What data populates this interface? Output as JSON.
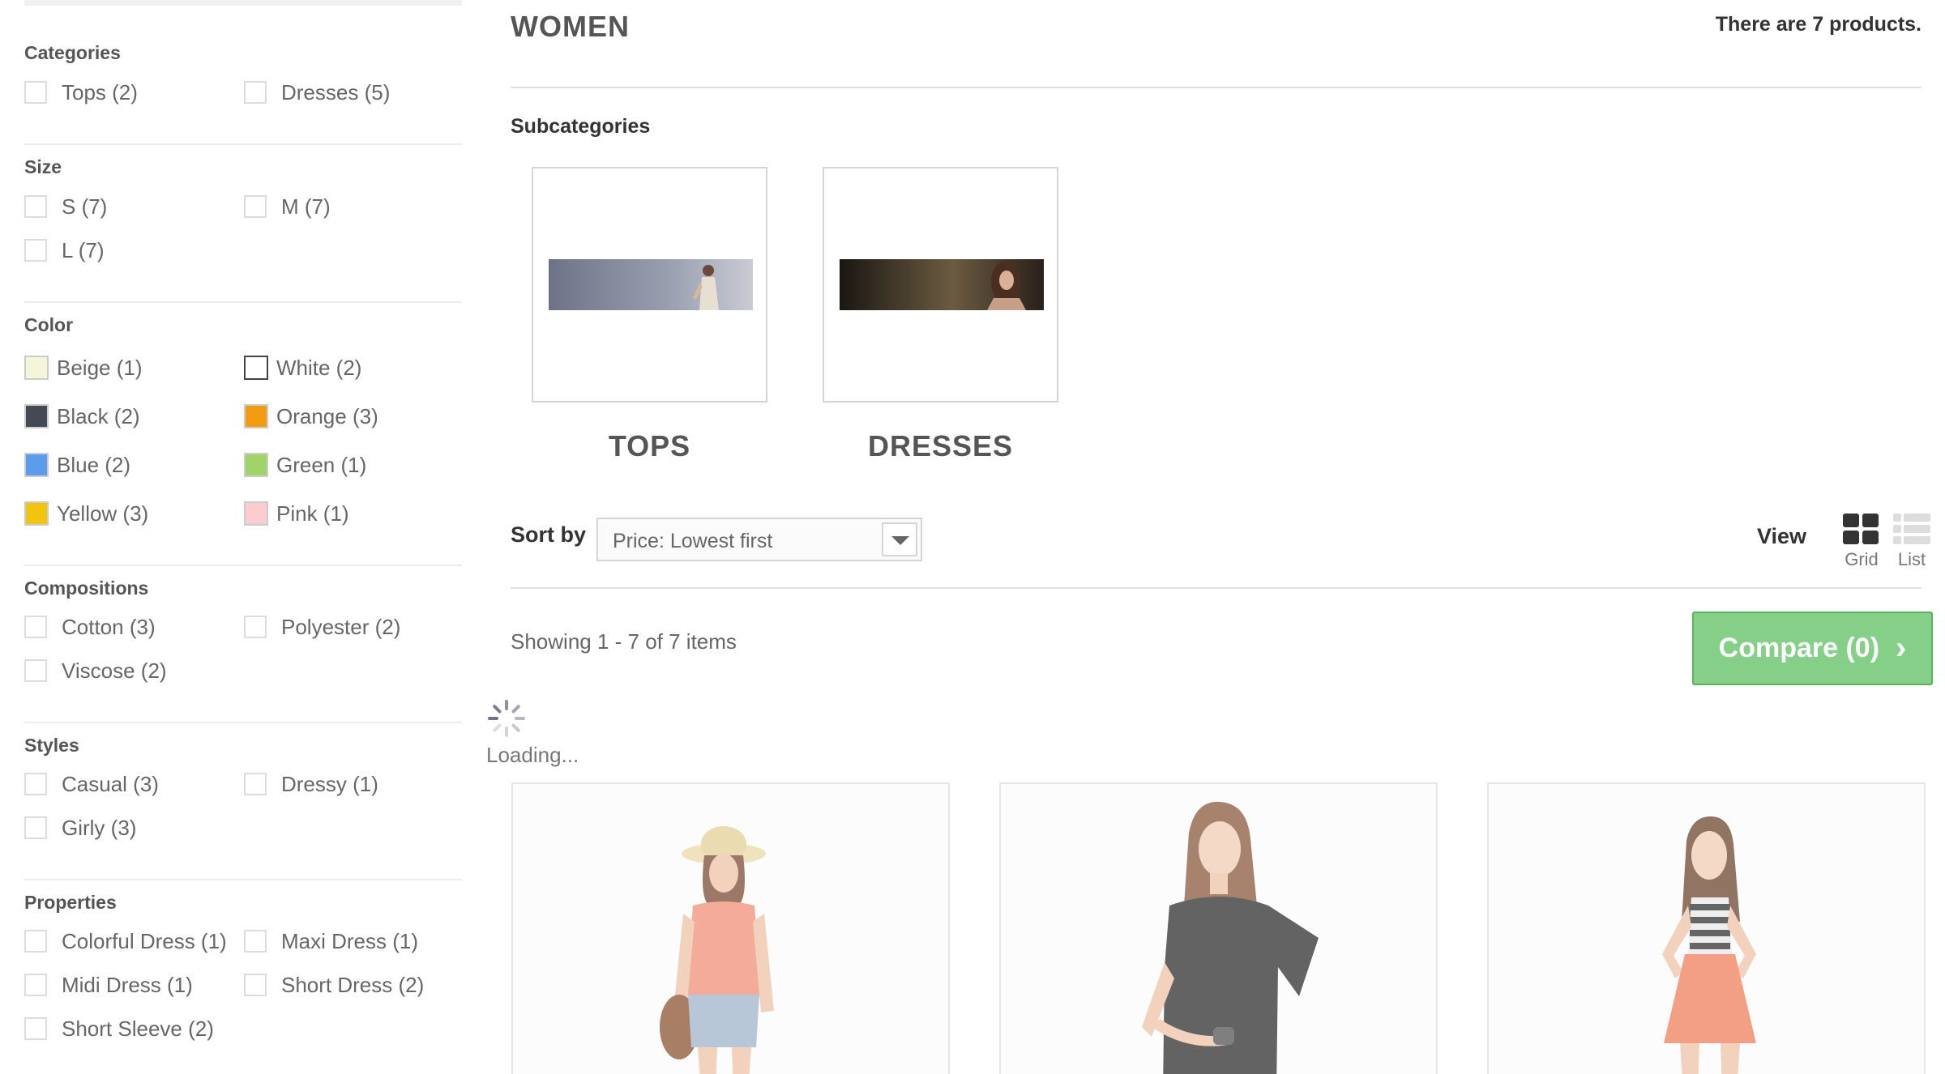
{
  "filters": {
    "categories": {
      "title": "Categories",
      "items": [
        "Tops (2)",
        "Dresses (5)"
      ]
    },
    "size": {
      "title": "Size",
      "items": [
        "S (7)",
        "M (7)",
        "L (7)"
      ]
    },
    "color": {
      "title": "Color",
      "items": [
        {
          "label": "Beige (1)",
          "color": "#f5f5dc"
        },
        {
          "label": "White (2)",
          "color": "#ffffff"
        },
        {
          "label": "Black (2)",
          "color": "#434a54"
        },
        {
          "label": "Orange (3)",
          "color": "#f39c11"
        },
        {
          "label": "Blue (2)",
          "color": "#5d9cec"
        },
        {
          "label": "Green (1)",
          "color": "#a0d468"
        },
        {
          "label": "Yellow (3)",
          "color": "#f1c40f"
        },
        {
          "label": "Pink (1)",
          "color": "#fcccd1"
        }
      ]
    },
    "compositions": {
      "title": "Compositions",
      "items": [
        "Cotton (3)",
        "Polyester (2)",
        "Viscose (2)"
      ]
    },
    "styles": {
      "title": "Styles",
      "items": [
        "Casual (3)",
        "Dressy (1)",
        "Girly (3)"
      ]
    },
    "properties": {
      "title": "Properties",
      "items": [
        "Colorful Dress (1)",
        "Maxi Dress (1)",
        "Midi Dress (1)",
        "Short Dress (2)",
        "Short Sleeve (2)"
      ]
    }
  },
  "main": {
    "title": "WOMEN",
    "product_count": "There are 7 products.",
    "subcategories_heading": "Subcategories",
    "subcategories": [
      "TOPS",
      "DRESSES"
    ],
    "sort": {
      "label": "Sort by",
      "value": "Price: Lowest first"
    },
    "view": {
      "label": "View",
      "grid": "Grid",
      "list": "List"
    },
    "showing": "Showing 1 - 7 of 7 items",
    "compare": "Compare (0)",
    "loading": "Loading..."
  }
}
